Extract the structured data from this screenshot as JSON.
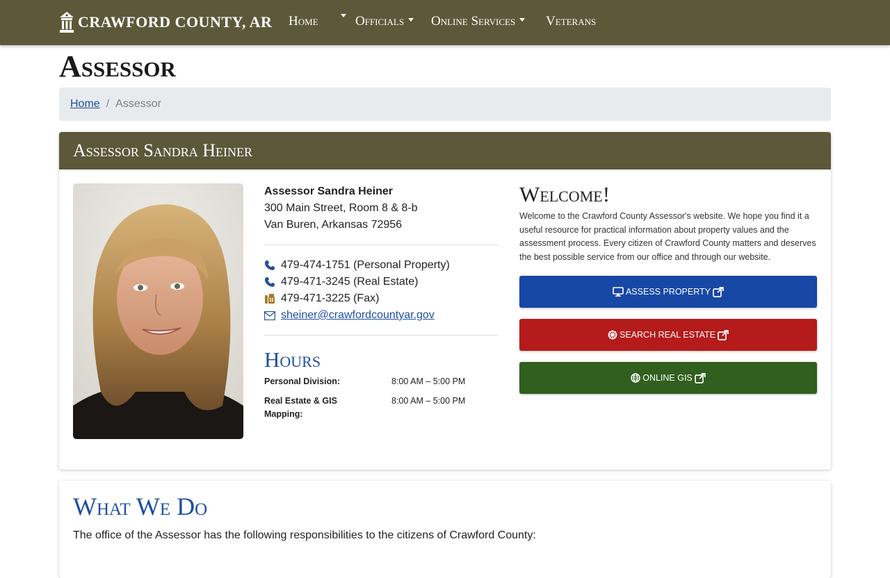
{
  "colors": {
    "brand": "#5e583a",
    "link": "#1f4fa0",
    "btn_assess": "#1848a5",
    "btn_search": "#b51b1b",
    "btn_gis": "#305f1e"
  },
  "navbar": {
    "brand": "CRAWFORD COUNTY, AR",
    "home": "Home",
    "officials": "Officials",
    "online_services": "Online Services",
    "veterans": "Veterans"
  },
  "page": {
    "title": "Assessor"
  },
  "breadcrumb": {
    "home": "Home",
    "separator": "/",
    "current": "Assessor"
  },
  "card": {
    "header": "Assessor Sandra Heiner",
    "contact": {
      "name": "Assessor Sandra Heiner",
      "address1": "300 Main Street, Room 8 & 8-b",
      "address2": "Van Buren, Arkansas 72956",
      "phone_personal": "479-474-1751 (Personal Property)",
      "phone_real_estate": "479-471-3245 (Real Estate)",
      "fax": "479-471-3225 (Fax)",
      "email": "sheiner@crawfordcountyar.gov"
    },
    "hours": {
      "title": "Hours",
      "rows": [
        {
          "label": "Personal Division:",
          "value": "8:00 AM – 5:00 PM"
        },
        {
          "label": "Real Estate & GIS Mapping:",
          "value": "8:00 AM – 5:00 PM"
        }
      ]
    },
    "welcome": {
      "title": "Welcome!",
      "text": "Welcome to the Crawford County Assessor's website. We hope you find it a useful resource for practical information about property values and the assessment process. Every citizen of Crawford County matters and deserves the best possible service from our office and through our website.",
      "buttons": {
        "assess": "Assess Property",
        "search": "Search Real Estate",
        "gis": "Online GIS"
      }
    }
  },
  "what_we_do": {
    "title": "What We Do",
    "intro": "The office of the Assessor has the following responsibilities to the citizens of Crawford County:"
  }
}
